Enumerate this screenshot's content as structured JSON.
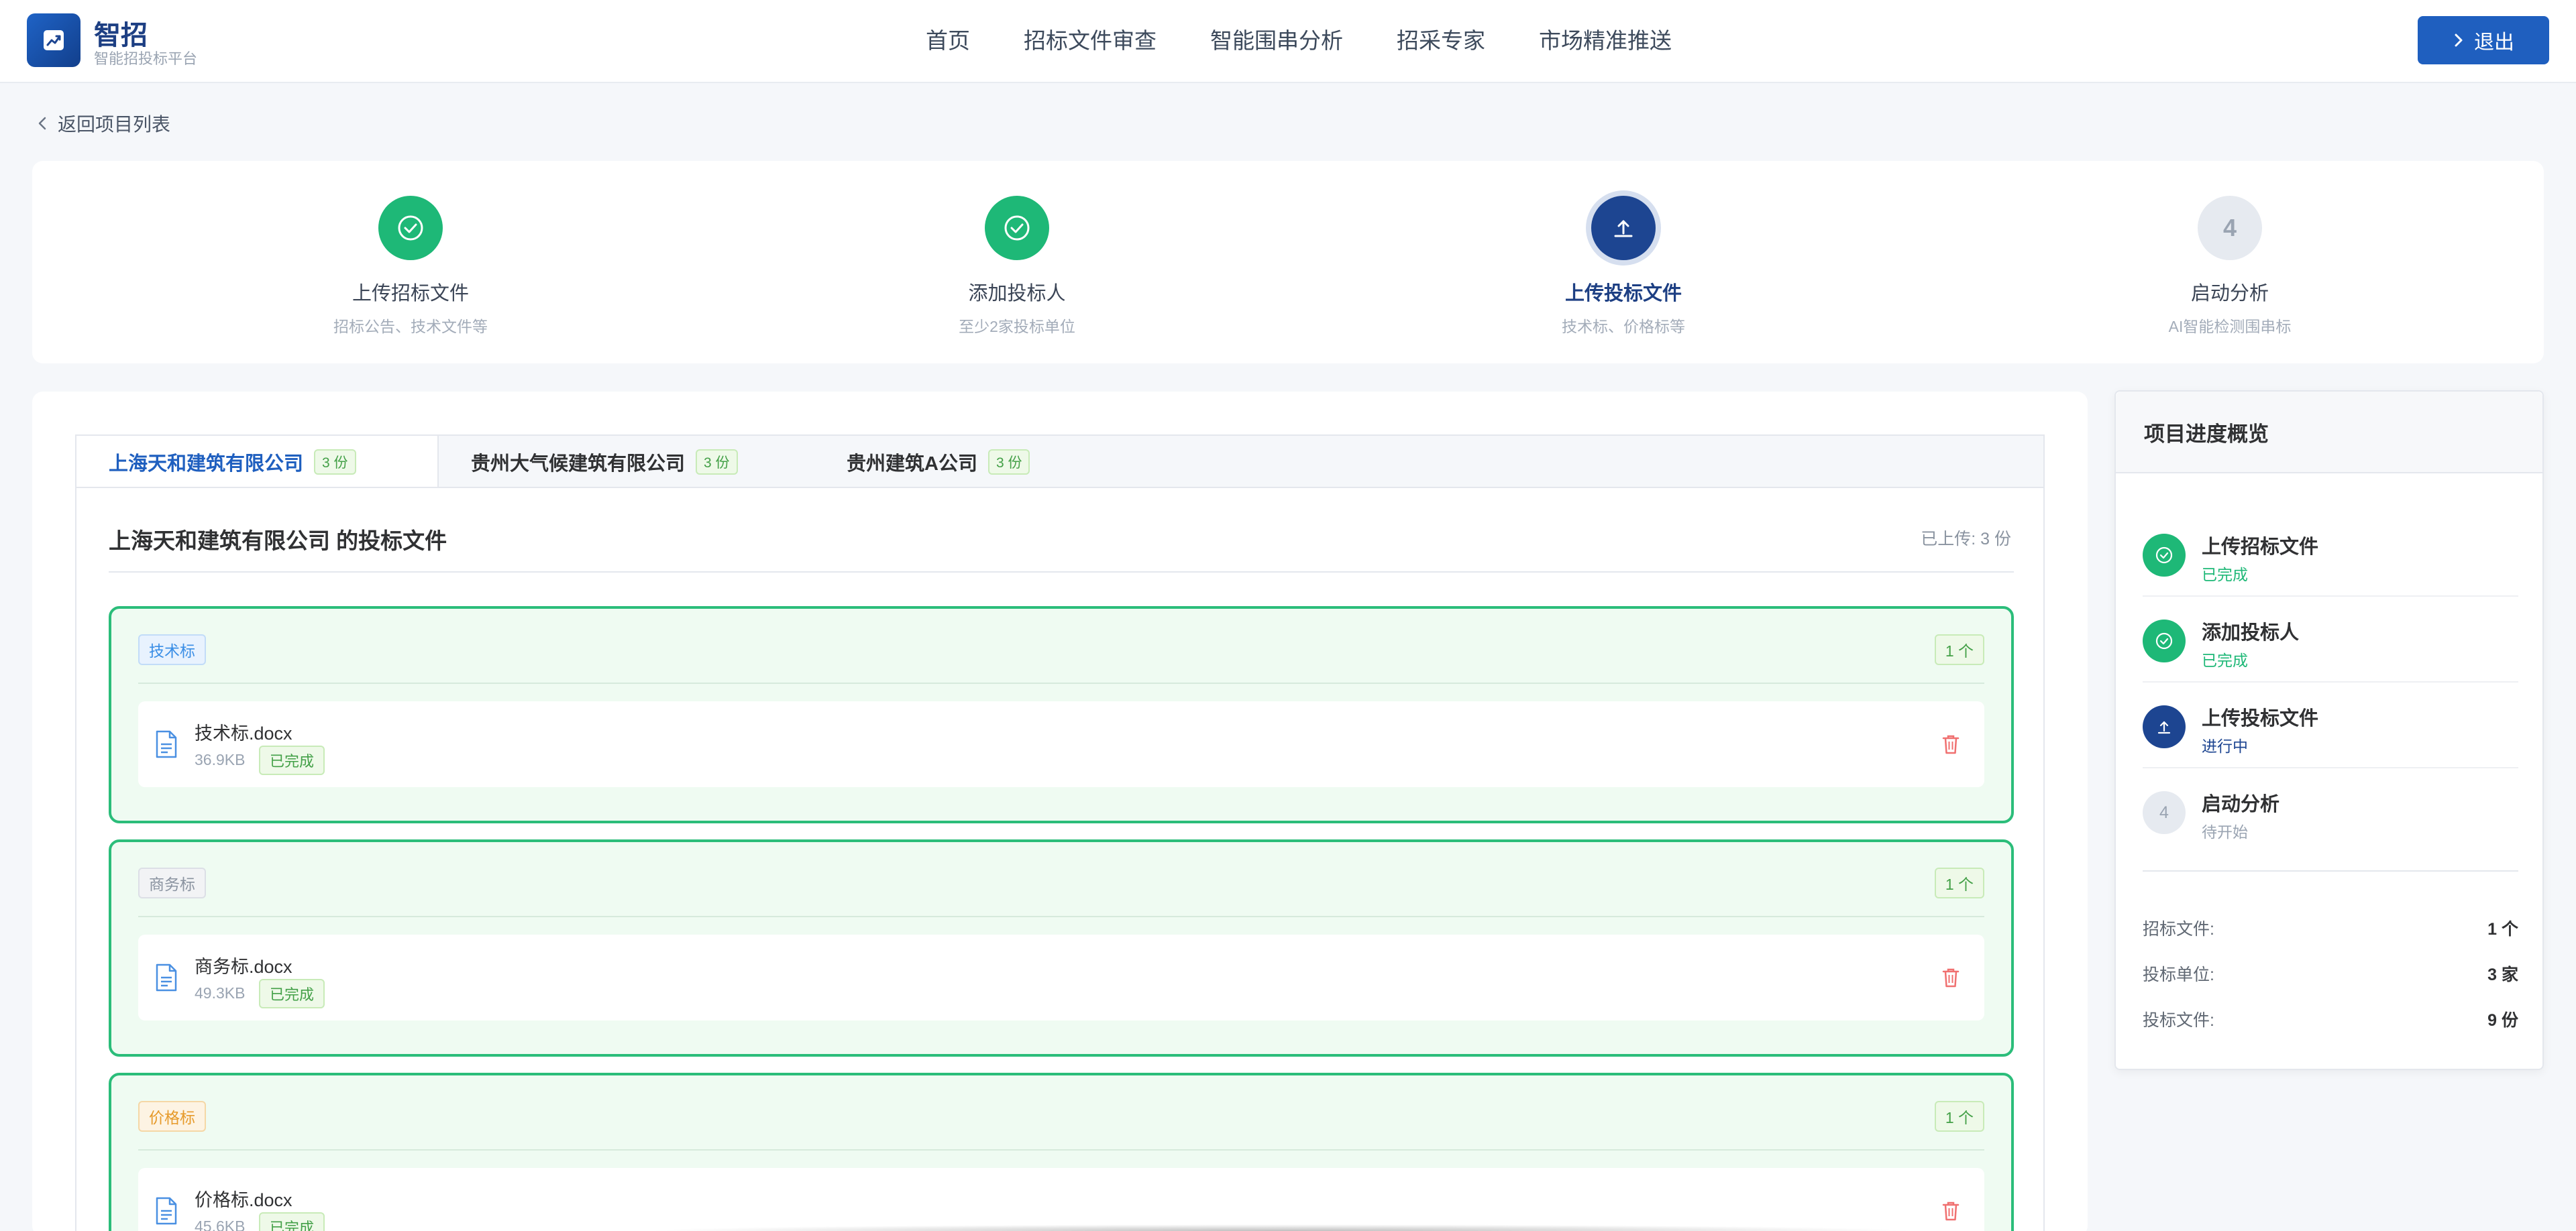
{
  "app": {
    "name": "智招",
    "subtitle": "智能招投标平台",
    "brand_color": "#1f5fbf"
  },
  "nav": {
    "items": [
      "首页",
      "招标文件审查",
      "智能围串分析",
      "招采专家",
      "市场精准推送"
    ]
  },
  "header": {
    "logout_label": "退出"
  },
  "back": {
    "label": "返回项目列表"
  },
  "steps": [
    {
      "title": "上传招标文件",
      "desc": "招标公告、技术文件等",
      "state": "done",
      "number": "1"
    },
    {
      "title": "添加投标人",
      "desc": "至少2家投标单位",
      "state": "done",
      "number": "2"
    },
    {
      "title": "上传投标文件",
      "desc": "技术标、价格标等",
      "state": "active",
      "number": "3"
    },
    {
      "title": "启动分析",
      "desc": "AI智能检测围串标",
      "state": "pending",
      "number": "4"
    }
  ],
  "tabs": [
    {
      "label": "上海天和建筑有限公司",
      "badge": "3 份",
      "active": true
    },
    {
      "label": "贵州大气候建筑有限公司",
      "badge": "3 份",
      "active": false
    },
    {
      "label": "贵州建筑A公司",
      "badge": "3 份",
      "active": false
    }
  ],
  "content": {
    "title": "上海天和建筑有限公司 的投标文件",
    "uploaded": "已上传: 3 份"
  },
  "groups": [
    {
      "tag": "技术标",
      "tag_color": "#3a8ee6",
      "count": "1 个",
      "file": {
        "name": "技术标.docx",
        "size": "36.9KB",
        "status": "已完成"
      }
    },
    {
      "tag": "商务标",
      "tag_color": "#8a93a0",
      "count": "1 个",
      "file": {
        "name": "商务标.docx",
        "size": "49.3KB",
        "status": "已完成"
      }
    },
    {
      "tag": "价格标",
      "tag_color": "#e69a2a",
      "count": "1 个",
      "file": {
        "name": "价格标.docx",
        "size": "45.6KB",
        "status": "已完成"
      }
    }
  ],
  "side": {
    "title": "项目进度概览",
    "progress": [
      {
        "title": "上传招标文件",
        "status": "已完成",
        "state": "done",
        "number": "1"
      },
      {
        "title": "添加投标人",
        "status": "已完成",
        "state": "done",
        "number": "2"
      },
      {
        "title": "上传投标文件",
        "status": "进行中",
        "state": "active",
        "number": "3"
      },
      {
        "title": "启动分析",
        "status": "待开始",
        "state": "pending",
        "number": "4"
      }
    ],
    "stats": [
      {
        "label": "招标文件:",
        "value": "1 个"
      },
      {
        "label": "投标单位:",
        "value": "3 家"
      },
      {
        "label": "投标文件:",
        "value": "9 份"
      }
    ]
  },
  "colors": {
    "success": "#1eb877",
    "active": "#1d4591",
    "pending": "#e6eaf0"
  }
}
